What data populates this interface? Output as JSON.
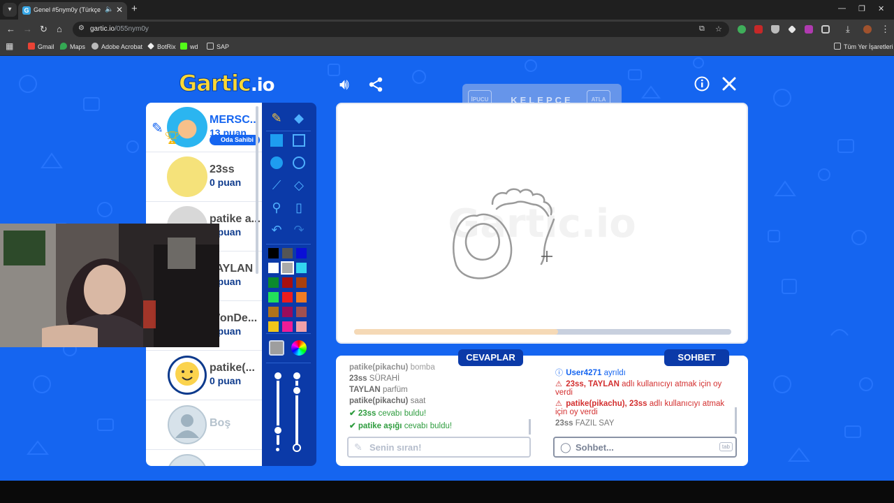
{
  "browser": {
    "tab_title": "Genel #5nym0y (Türkçe) - G",
    "url_domain": "gartic.io",
    "url_path": "/055nym0y",
    "bookmarks": [
      "Gmail",
      "Maps",
      "Adobe Acrobat",
      "BotRix",
      "wd",
      "SAP"
    ],
    "all_bookmarks": "Tüm Yer İşaretleri"
  },
  "game": {
    "logo_main": "Gartic",
    "logo_suffix": ".io",
    "hint": {
      "left_btn": "İPUCU",
      "word": "KELEPÇE",
      "right_btn": "ATLA"
    },
    "timer_progress": 0.54
  },
  "players": [
    {
      "name": "MERSC...",
      "score": "13 puan",
      "badge": "Oda Sahibi",
      "drawing": true
    },
    {
      "name": "23ss",
      "score": "0 puan"
    },
    {
      "name": "patike a...",
      "score": "0 puan"
    },
    {
      "name": "TAYLAN",
      "score": "0 puan"
    },
    {
      "name": "WonDe...",
      "score": "0 puan"
    },
    {
      "name": "patike(...",
      "score": "0 puan"
    },
    {
      "name": "Boş",
      "score": ""
    }
  ],
  "panels": {
    "answers_tab": "CEVAPLAR",
    "chat_tab": "SOHBET",
    "answers_placeholder": "Senin sıran!",
    "chat_placeholder": "Sohbet...",
    "tab_key": "tab"
  },
  "answers": [
    {
      "name": "patike(pikachu)",
      "text": "bomba"
    },
    {
      "name": "23ss",
      "text": "SÜRAHİ"
    },
    {
      "name": "TAYLAN",
      "text": "parfüm"
    },
    {
      "name": "patike(pikachu)",
      "text": "saat"
    },
    {
      "name": "23ss",
      "text": "cevabı buldu!",
      "correct": true
    },
    {
      "name": "patike aşığı",
      "text": "cevabı buldu!",
      "correct": true
    }
  ],
  "chat": [
    {
      "type": "info",
      "name": "User4271",
      "text": "ayrıldı"
    },
    {
      "type": "warn",
      "name": "23ss, TAYLAN",
      "text": "adlı kullanıcıyı atmak için oy verdi"
    },
    {
      "type": "warn",
      "name": "patike(pikachu), 23ss",
      "text": "adlı kullanıcıyı atmak için oy verdi"
    },
    {
      "type": "plain",
      "name": "23ss",
      "text": "FAZIL SAY"
    }
  ],
  "colors": {
    "background": "#1565f0",
    "panel_dark": "#0b3aa8",
    "score": "#0d3a8c",
    "correct": "#2e9c3e",
    "warn": "#d32f2f",
    "palette": [
      "#000000",
      "#555555",
      "#0a0fd6",
      "#ffffff",
      "#aaaaaa",
      "#33d6f0",
      "#0b8a2c",
      "#a80f0f",
      "#a8400f",
      "#22e05a",
      "#ee1c1c",
      "#f07b22",
      "#b0721a",
      "#9a0c5a",
      "#a05050",
      "#f0c51a",
      "#f01c96",
      "#f0a0a8"
    ],
    "selected_color": "#aaaaaa"
  },
  "icons": {
    "sound": "speaker-icon",
    "share": "share-icon",
    "info": "info-icon",
    "close": "close-icon"
  }
}
